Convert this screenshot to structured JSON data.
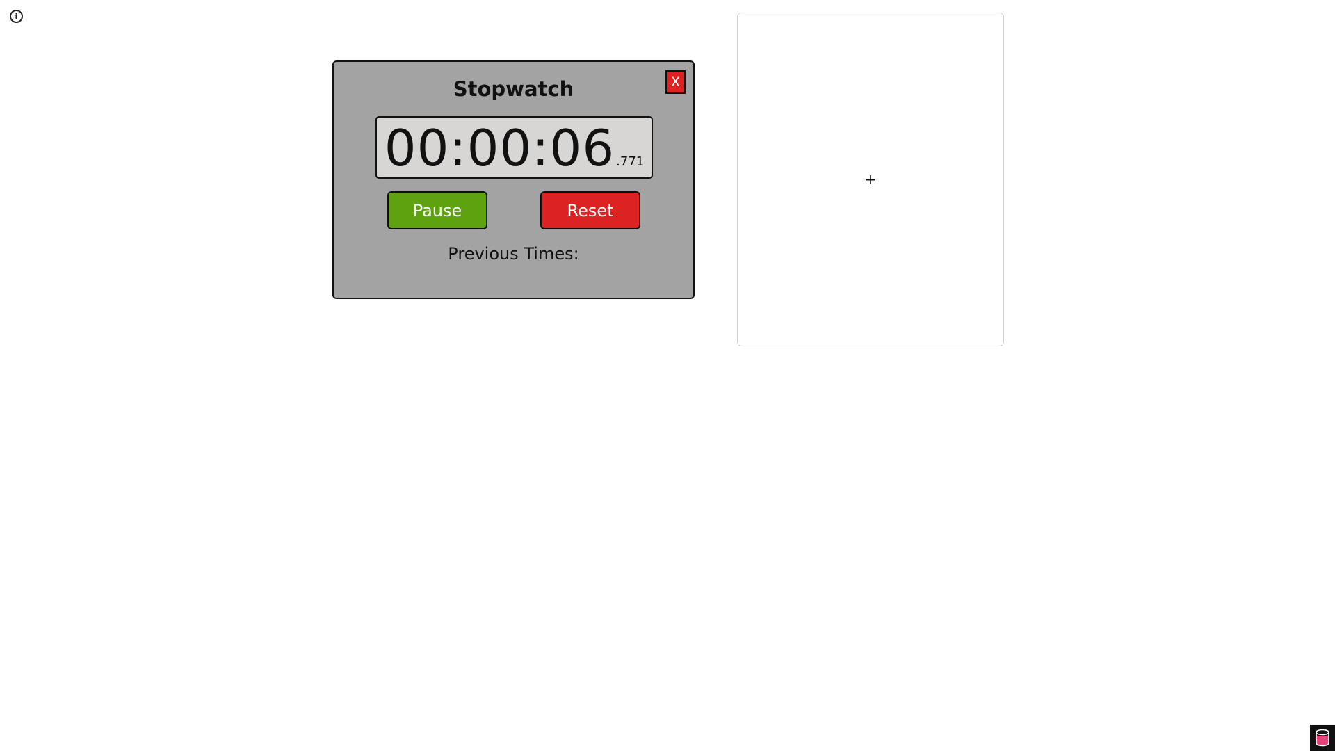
{
  "info": {
    "icon": "info-icon",
    "glyph": "i"
  },
  "stopwatch": {
    "title": "Stopwatch",
    "close_label": "X",
    "time_main": "00:00:06",
    "time_ms": ".771",
    "pause_label": "Pause",
    "reset_label": "Reset",
    "previous_label": "Previous Times:"
  },
  "add_card": {
    "icon": "plus-icon",
    "glyph": "+"
  },
  "logo": {
    "icon": "database-stack-icon"
  },
  "colors": {
    "panel_bg": "#a3a3a3",
    "display_bg": "#d8d6d5",
    "pause_green": "#5ea20f",
    "reset_red": "#dd2222",
    "logo_pink": "#e8427a"
  }
}
